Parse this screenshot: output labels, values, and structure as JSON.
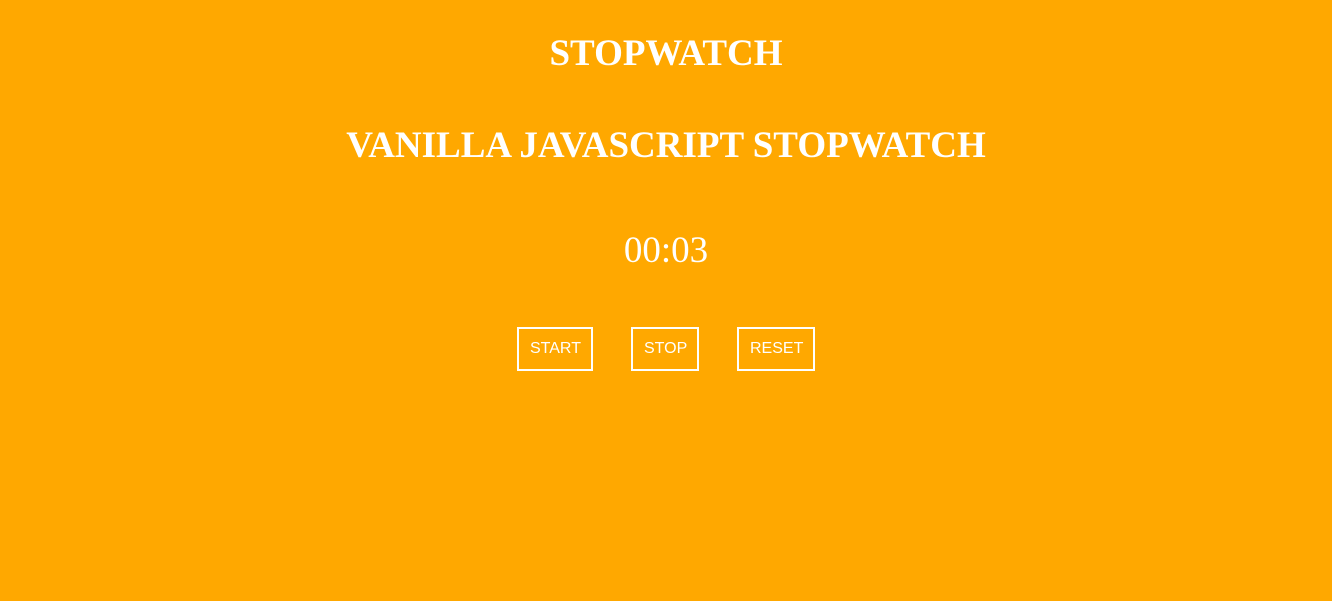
{
  "header": {
    "title": "STOPWATCH",
    "subtitle": "VANILLA JAVASCRIPT STOPWATCH"
  },
  "timer": {
    "display": "00:03"
  },
  "controls": {
    "start_label": "START",
    "stop_label": "STOP",
    "reset_label": "RESET"
  },
  "colors": {
    "background": "#FFA800",
    "foreground": "#FFFFFF"
  }
}
